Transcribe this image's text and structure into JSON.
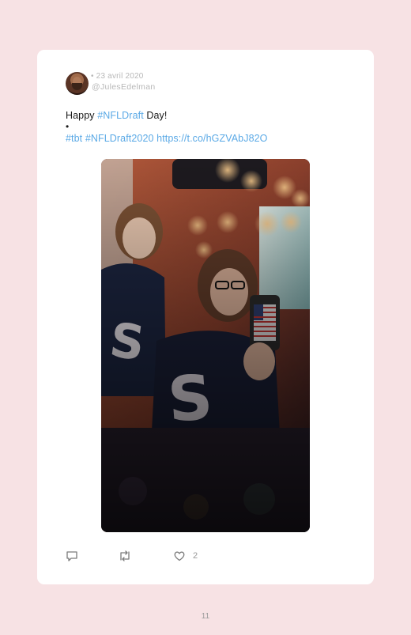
{
  "tweet": {
    "date": "• 23 avril 2020",
    "handle": "@JulesEdelman",
    "text_prefix": "Happy ",
    "hashtag_1": "#NFLDraft",
    "text_suffix": " Day!",
    "bullet": "•",
    "hashtag_2": "#tbt",
    "hashtag_3": "#NFLDraft2020",
    "url": "https://t.co/hGZVAbJ82O"
  },
  "actions": {
    "reply_icon": "reply-icon",
    "retweet_icon": "retweet-icon",
    "like_icon": "heart-icon",
    "like_count": "2"
  },
  "page": {
    "number": "11"
  },
  "colors": {
    "background": "#f7e2e4",
    "card": "#ffffff",
    "link": "#5aa9e6",
    "muted": "#b8b8b8"
  }
}
